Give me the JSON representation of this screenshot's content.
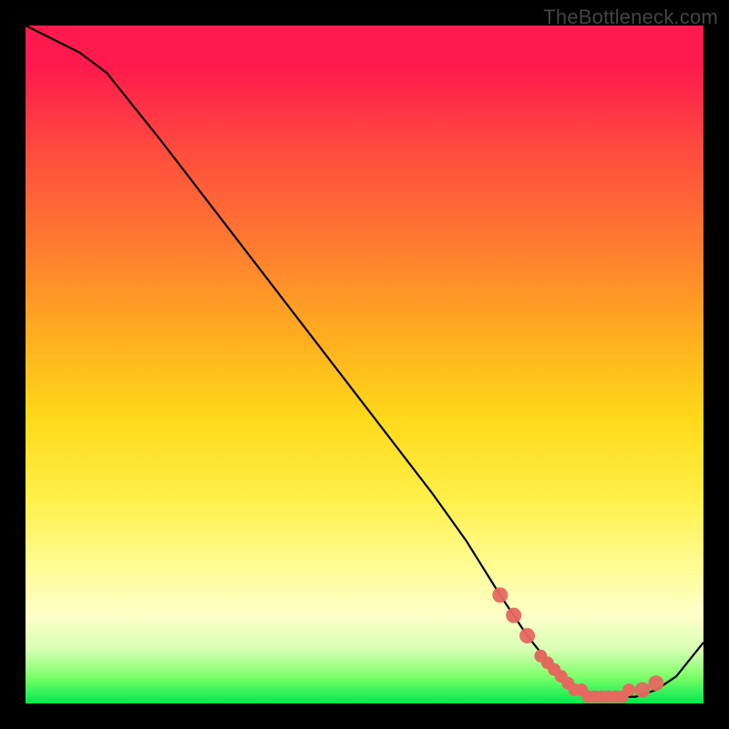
{
  "watermark": "TheBottleneck.com",
  "colors": {
    "bg": "#000000",
    "gradient_top": "#ff1a4d",
    "gradient_mid": "#ffd91a",
    "gradient_bottom": "#00e84e",
    "curve": "#000000",
    "dots": "#e5695f"
  },
  "chart_data": {
    "type": "line",
    "title": "",
    "xlabel": "",
    "ylabel": "",
    "xlim": [
      0,
      100
    ],
    "ylim": [
      0,
      100
    ],
    "series": [
      {
        "name": "curve",
        "x": [
          0,
          4,
          8,
          12,
          20,
          30,
          40,
          50,
          60,
          65,
          70,
          74,
          78,
          82,
          86,
          90,
          93,
          96,
          100
        ],
        "y": [
          100,
          98,
          96,
          93,
          83,
          70,
          57,
          44,
          31,
          24,
          16,
          10,
          5,
          2,
          1,
          1,
          2,
          4,
          9
        ]
      }
    ],
    "marker_band": {
      "name": "optimal-range-dots",
      "x": [
        70,
        72,
        74,
        76,
        77,
        78,
        79,
        80,
        81,
        82,
        83,
        84,
        85,
        86,
        87,
        88,
        89,
        91,
        93
      ],
      "y": [
        16,
        13,
        10,
        7,
        6,
        5,
        4,
        3,
        2,
        2,
        1,
        1,
        1,
        1,
        1,
        1,
        2,
        2,
        3
      ]
    },
    "annotations": []
  }
}
